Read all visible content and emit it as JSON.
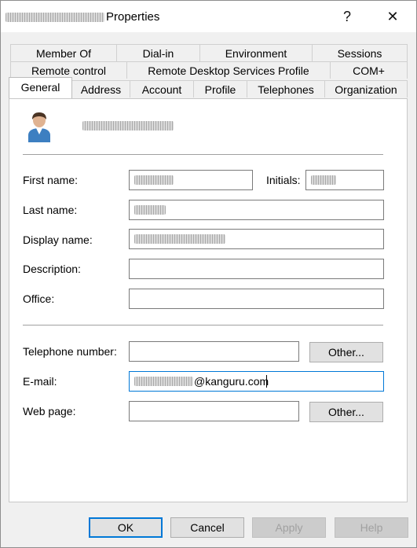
{
  "window": {
    "title": "Properties",
    "help_label": "?",
    "close_label": "✕"
  },
  "tabs_row1": [
    "Member Of",
    "Dial-in",
    "Environment",
    "Sessions"
  ],
  "tabs_row2": [
    "Remote control",
    "Remote Desktop Services Profile",
    "COM+"
  ],
  "tabs_row3": [
    "General",
    "Address",
    "Account",
    "Profile",
    "Telephones",
    "Organization"
  ],
  "active_tab": "General",
  "form": {
    "first_name_label": "First name:",
    "initials_label": "Initials:",
    "last_name_label": "Last name:",
    "display_name_label": "Display name:",
    "description_label": "Description:",
    "office_label": "Office:",
    "telephone_label": "Telephone number:",
    "email_label": "E-mail:",
    "email_value": "@kanguru.com",
    "webpage_label": "Web page:",
    "other_button_1": "Other...",
    "other_button_2": "Other..."
  },
  "footer": {
    "ok": "OK",
    "cancel": "Cancel",
    "apply": "Apply",
    "help": "Help"
  },
  "icons": {
    "user_icon": "user-avatar-icon"
  }
}
